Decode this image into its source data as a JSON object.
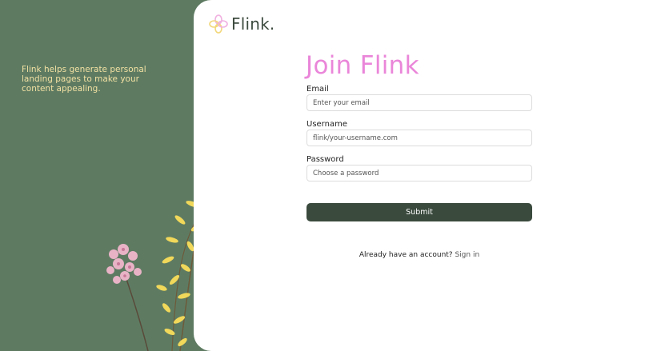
{
  "sidebar": {
    "tagline": "Flink helps generate personal landing pages to make your content appealing."
  },
  "brand": {
    "name": "Flink."
  },
  "form": {
    "title": "Join Flink",
    "email": {
      "label": "Email",
      "placeholder": "Enter your email"
    },
    "username": {
      "label": "Username",
      "placeholder": "flink/your-username.com"
    },
    "password": {
      "label": "Password",
      "placeholder": "Choose a password"
    },
    "submit_label": "Submit"
  },
  "footer": {
    "prompt": "Already have an account?",
    "signin_label": "Sign in"
  },
  "colors": {
    "sidebar_bg": "#5e7b62",
    "tagline": "#f2e0a2",
    "title": "#ea86d9",
    "button": "#3a4a3d"
  }
}
